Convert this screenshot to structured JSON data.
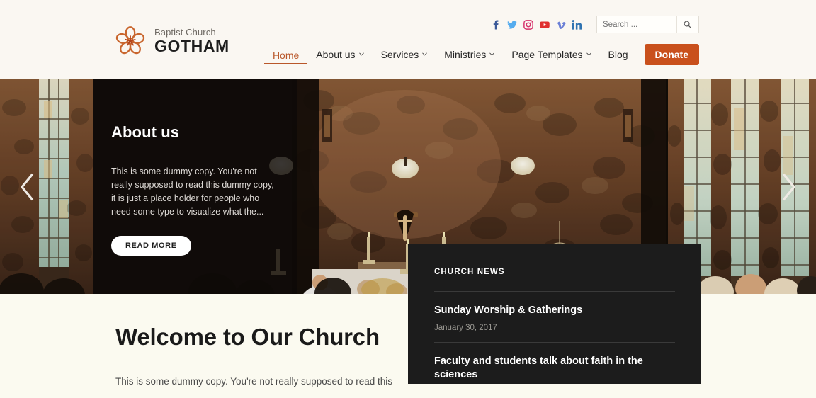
{
  "brand": {
    "logo_icon": "flower-logo-icon",
    "sub_text": "Baptist Church",
    "main_text": "GOTHAM",
    "accent_color": "#c9501c"
  },
  "social": [
    {
      "name": "facebook-icon",
      "label": "Facebook",
      "color": "#3b5998"
    },
    {
      "name": "twitter-icon",
      "label": "Twitter",
      "color": "#55acee"
    },
    {
      "name": "instagram-icon",
      "label": "Instagram",
      "color": "#d6336c"
    },
    {
      "name": "youtube-icon",
      "label": "YouTube",
      "color": "#e02f2f"
    },
    {
      "name": "vimeo-icon",
      "label": "Vimeo",
      "color": "#6a7fd6"
    },
    {
      "name": "linkedin-icon",
      "label": "LinkedIn",
      "color": "#2f73b1"
    }
  ],
  "search": {
    "placeholder": "Search ...",
    "value": "",
    "button_icon": "search-icon"
  },
  "nav": {
    "items": [
      {
        "label": "Home",
        "active": true,
        "has_dropdown": false
      },
      {
        "label": "About us",
        "active": false,
        "has_dropdown": true
      },
      {
        "label": "Services",
        "active": false,
        "has_dropdown": true
      },
      {
        "label": "Ministries",
        "active": false,
        "has_dropdown": true
      },
      {
        "label": "Page Templates",
        "active": false,
        "has_dropdown": true
      },
      {
        "label": "Blog",
        "active": false,
        "has_dropdown": false
      }
    ],
    "donate_label": "Donate"
  },
  "hero": {
    "title": "About us",
    "body": "This is some dummy copy. You're not really supposed to read this dummy copy, it is just a place holder for people who need some type to visualize what the...",
    "button_label": "READ MORE",
    "prev_icon": "chevron-left-icon",
    "next_icon": "chevron-right-icon",
    "image_alt": "church-interior-altar-crucifix"
  },
  "news": {
    "label": "CHURCH NEWS",
    "items": [
      {
        "headline": "Sunday Worship & Gatherings",
        "date": "January 30, 2017"
      },
      {
        "headline": "Faculty and students talk about faith in the sciences",
        "date": ""
      }
    ]
  },
  "welcome": {
    "title": "Welcome to Our Church",
    "body": "This is some dummy copy. You're not really supposed to read this"
  }
}
